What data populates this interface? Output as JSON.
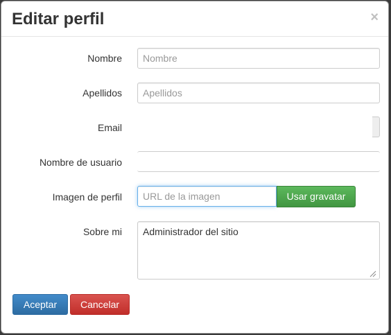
{
  "modal": {
    "title": "Editar perfil",
    "close_symbol": "×"
  },
  "form": {
    "nombre": {
      "label": "Nombre",
      "placeholder": "Nombre",
      "value": ""
    },
    "apellidos": {
      "label": "Apellidos",
      "placeholder": "Apellidos",
      "value": ""
    },
    "email": {
      "label": "Email"
    },
    "username": {
      "label": "Nombre de usuario"
    },
    "imagen": {
      "label": "Imagen de perfil",
      "placeholder": "URL de la imagen",
      "button_label": "Usar gravatar"
    },
    "sobre_mi": {
      "label": "Sobre mi",
      "value": "Administrador del sitio"
    }
  },
  "actions": {
    "accept_label": "Aceptar",
    "cancel_label": "Cancelar"
  },
  "colors": {
    "primary": "#428bca",
    "success": "#5cb85c",
    "danger": "#d9534f",
    "focus": "#66afe9"
  },
  "icons": {
    "close": "close-icon",
    "resize": "resize-grip-icon"
  }
}
